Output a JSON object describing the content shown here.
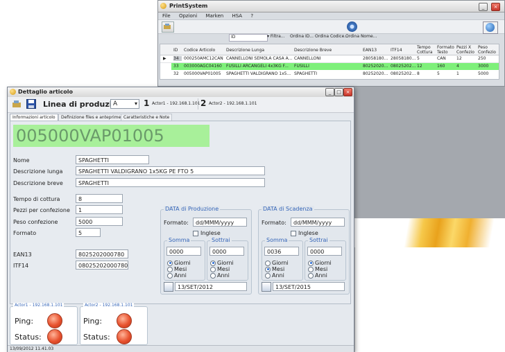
{
  "ps": {
    "title": "PrintSystem",
    "menu": [
      "File",
      "Opzioni",
      "Marken",
      "HSA",
      "?"
    ],
    "filter": {
      "column": "ID",
      "dropdown": "Filtra...",
      "sort_buttons": [
        "Ordina ID...",
        "Ordina Codice...",
        "Ordina Nome..."
      ]
    },
    "table": {
      "headers": [
        "ID",
        "Codice Articolo",
        "Descrizione Lunga",
        "Descrizione Breve",
        "EAN13",
        "ITF14",
        "Tempo Cottura",
        "Formato Testo",
        "Pezzi X Confezio",
        "Peso Confezio"
      ],
      "rows": [
        [
          "34",
          "000250AMC12CAN",
          "CANNELLONI SEMOLA CASA A...",
          "CANNELLONI",
          "28058180...",
          "28058180...",
          "5",
          "CAN",
          "12",
          "250"
        ],
        [
          "33",
          "003000AGC04160",
          "FUSILLI ARCANGELI 4x3KG F...",
          "FUSILLI",
          "80252020...",
          "08025202...",
          "12",
          "160",
          "4",
          "3000"
        ],
        [
          "32",
          "005000VAP01005",
          "SPAGHETTI VALDIGRANO 1x5...",
          "SPAGHETTI",
          "80252020...",
          "08025202...",
          "8",
          "5",
          "1",
          "5000"
        ]
      ]
    }
  },
  "dlg": {
    "title": "Dettaglio articolo",
    "line_label": "Linea di produzione:",
    "line_value": "A",
    "actors": [
      {
        "num": "1",
        "label": "Actor1 - 192.168.1.101"
      },
      {
        "num": "2",
        "label": "Actor2 - 192.168.1.101"
      }
    ],
    "tabs": [
      "Informazioni articolo",
      "Definizione files e anteprime",
      "Caratteristiche e Note"
    ],
    "code": "005000VAP01005",
    "labels": {
      "nome": "Nome",
      "desc_lunga": "Descrizione lunga",
      "desc_breve": "Descrizione breve",
      "tempo": "Tempo di cottura",
      "pezzi": "Pezzi per confezione",
      "peso": "Peso confezione",
      "formato": "Formato",
      "ean": "EAN13",
      "itf": "ITF14"
    },
    "values": {
      "nome": "SPAGHETTI",
      "desc_lunga": "SPAGHETTI VALDIGRANO 1x5KG PE FTO 5",
      "desc_breve": "SPAGHETTI",
      "tempo": "8",
      "pezzi": "1",
      "peso": "5000",
      "formato": "5",
      "ean": "8025202000780",
      "itf": "08025202000780"
    },
    "prod": {
      "title": "DATA di Produzione",
      "formato_label": "Formato:",
      "formato_value": "dd/MMM/yyyy",
      "inglese": "Inglese",
      "somma": "Somma",
      "sottrai": "Sottrai",
      "somma_value": "0000",
      "sottrai_value": "0000",
      "somma_sel": "Giorni",
      "sottrai_sel": "Giorni",
      "date": "13/SET/2012"
    },
    "scad": {
      "title": "DATA di Scadenza",
      "formato_label": "Formato:",
      "formato_value": "dd/MMM/yyyy",
      "inglese": "Inglese",
      "somma": "Somma",
      "sottrai": "Sottrai",
      "somma_value": "0036",
      "sottrai_value": "0000",
      "somma_sel": "Mesi",
      "sottrai_sel": "Giorni",
      "date": "13/SET/2015"
    },
    "units": [
      "Giorni",
      "Mesi",
      "Anni"
    ],
    "status_panels": [
      {
        "title": "Actor1 - 192.168.1.101",
        "ping": "Ping:",
        "status": "Status:"
      },
      {
        "title": "Actor2 - 192.168.1.101",
        "ping": "Ping:",
        "status": "Status:"
      }
    ],
    "statusbar": "13/09/2012 11.41.03"
  },
  "colors": {
    "highlight_row": "#7ef07a",
    "code_bg": "#a8f09a",
    "code_text": "#6a9a6a",
    "group_title": "#3565b8",
    "led": "#e8522e"
  }
}
